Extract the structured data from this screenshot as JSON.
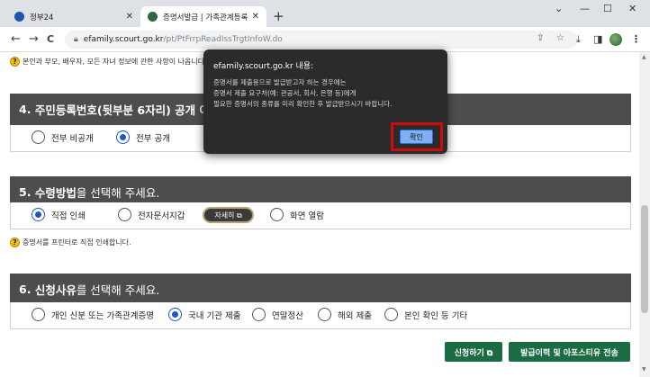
{
  "browser": {
    "tabs": [
      {
        "title": "정부24",
        "active": false,
        "favicon_color": "#1a56b0"
      },
      {
        "title": "증명서발급 | 가족관계등록부",
        "active": true,
        "favicon_color": "#2c6a3e"
      }
    ],
    "new_tab": "+",
    "window_controls": [
      "⌄",
      "—",
      "☐",
      "✕"
    ],
    "nav": {
      "back": "←",
      "forward": "→",
      "reload": "C"
    },
    "url_host": "efamily.scourt.go.kr",
    "url_path": "/pt/PtFrrpReadIssTrgtInfoW.do",
    "toolbar_icons": [
      "share-icon",
      "star-icon",
      "download-icon",
      "sidebar-icon",
      "profile-icon",
      "menu-icon"
    ]
  },
  "page": {
    "top_info": "본인과 부모, 배우자, 모든 자녀 정보에 관한 사항이 나옵니다",
    "section4": {
      "number": "4.",
      "title": "주민등록번호(뒷부분 6자리) 공개 여부",
      "options": [
        {
          "label": "전부 비공개",
          "selected": false
        },
        {
          "label": "전부 공개",
          "selected": true
        }
      ]
    },
    "section5": {
      "number": "5.",
      "highlight": "수령방법",
      "rest": "을 선택해 주세요.",
      "options": [
        {
          "label": "직접 인쇄",
          "selected": true
        },
        {
          "label": "전자문서지갑",
          "selected": false
        },
        {
          "label": "화면 열람",
          "selected": false
        }
      ],
      "detail_button": "자세히 ⧉",
      "info": "증명서를 프린터로 직접 인쇄합니다."
    },
    "section6": {
      "number": "6.",
      "highlight": "신청사유",
      "rest": "를 선택해 주세요.",
      "options": [
        {
          "label": "개인 신분 또는 가족관계증명",
          "selected": false
        },
        {
          "label": "국내 기관 제출",
          "selected": true
        },
        {
          "label": "연말정산",
          "selected": false
        },
        {
          "label": "해외 제출",
          "selected": false
        },
        {
          "label": "본인 확인 등 기타",
          "selected": false
        }
      ]
    },
    "buttons": {
      "apply": "신청하기 ⧉",
      "history": "발급이력 및 아포스티유 전송"
    }
  },
  "dialog": {
    "title": "efamily.scourt.go.kr 내용:",
    "lines": [
      "증명서를 제출용으로 발급받고자 하는 경우에는",
      "증명서 제출 요구처(예: 관공서, 회사, 은행 등)에게",
      "필요한 증명서의 종류를 미리 확인한 후 발급받으시기 바랍니다."
    ],
    "ok_label": "확인"
  },
  "colors": {
    "section_header": "#4d4d4d",
    "selected_radio": "#1e56c6",
    "action_button": "#1b6b43",
    "highlight_box": "#d10b0b",
    "dialog_bg": "#2b2b2b"
  }
}
